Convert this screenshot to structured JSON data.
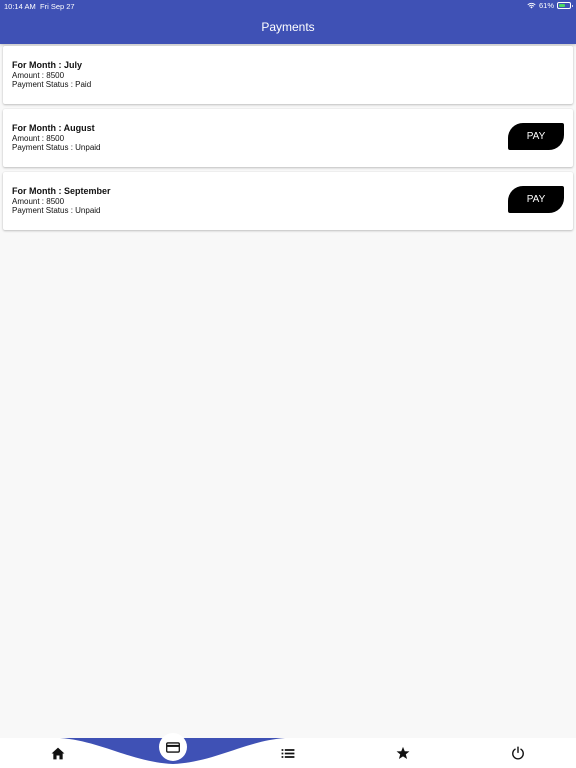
{
  "status_bar": {
    "time": "10:14 AM",
    "date": "Fri Sep 27",
    "battery": "61%",
    "battery_level": 0.61
  },
  "header": {
    "title": "Payments"
  },
  "payments": [
    {
      "month": "For Month : July",
      "amount": "Amount : 8500",
      "status": "Payment Status : Paid",
      "pay_label": ""
    },
    {
      "month": "For Month : August",
      "amount": "Amount : 8500",
      "status": "Payment Status : Unpaid",
      "pay_label": "PAY"
    },
    {
      "month": "For Month : September",
      "amount": "Amount : 8500",
      "status": "Payment Status : Unpaid",
      "pay_label": "PAY"
    }
  ],
  "bottom_nav": {
    "items": [
      {
        "icon": "home-icon",
        "active": false
      },
      {
        "icon": "card-icon",
        "active": true
      },
      {
        "icon": "list-icon",
        "active": false
      },
      {
        "icon": "star-icon",
        "active": false
      },
      {
        "icon": "power-icon",
        "active": false
      }
    ]
  },
  "colors": {
    "primary": "#3f51b5",
    "pay_button": "#000000",
    "background": "#f8f8f8"
  }
}
